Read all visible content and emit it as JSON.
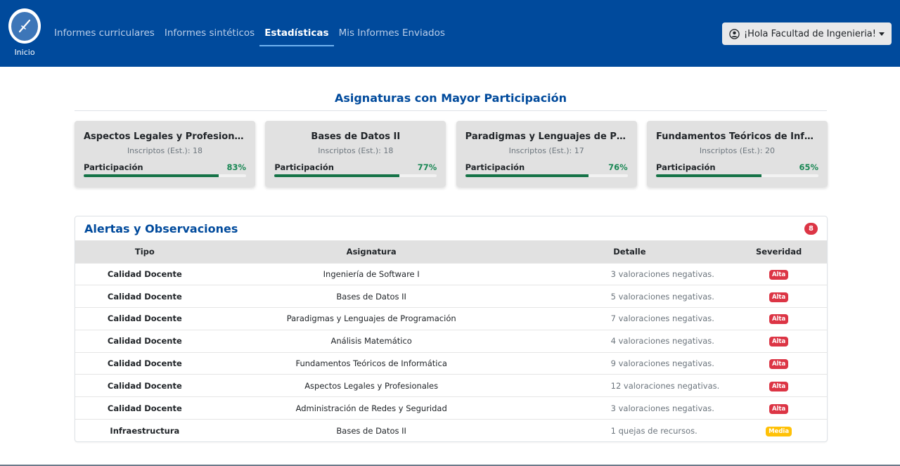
{
  "nav": {
    "brand_label": "Inicio",
    "links": [
      {
        "label": "Informes curriculares",
        "active": false
      },
      {
        "label": "Informes sintéticos",
        "active": false
      },
      {
        "label": "Estadísticas",
        "active": true
      },
      {
        "label": "Mis Informes Enviados",
        "active": false
      }
    ],
    "user_label": "¡Hola Facultad de Ingenieria!"
  },
  "participation": {
    "title": "Asignaturas con Mayor Participación",
    "cards": [
      {
        "title": "Aspectos Legales y Profesionales",
        "subtitle": "Inscriptos (Est.): 18",
        "label": "Participación",
        "percent_label": "83%",
        "percent": 83
      },
      {
        "title": "Bases de Datos II",
        "subtitle": "Inscriptos (Est.): 18",
        "label": "Participación",
        "percent_label": "77%",
        "percent": 77
      },
      {
        "title": "Paradigmas y Lenguajes de Progr...",
        "subtitle": "Inscriptos (Est.): 17",
        "label": "Participación",
        "percent_label": "76%",
        "percent": 76
      },
      {
        "title": "Fundamentos Teóricos de Inform...",
        "subtitle": "Inscriptos (Est.): 20",
        "label": "Participación",
        "percent_label": "65%",
        "percent": 65
      }
    ]
  },
  "alerts": {
    "title": "Alertas y Observaciones",
    "count": "8",
    "columns": [
      "Tipo",
      "Asignatura",
      "Detalle",
      "Severidad"
    ],
    "rows": [
      {
        "tipo": "Calidad Docente",
        "asignatura": "Ingeniería de Software I",
        "detalle": "3 valoraciones negativas.",
        "severidad": "Alta"
      },
      {
        "tipo": "Calidad Docente",
        "asignatura": "Bases de Datos II",
        "detalle": "5 valoraciones negativas.",
        "severidad": "Alta"
      },
      {
        "tipo": "Calidad Docente",
        "asignatura": "Paradigmas y Lenguajes de Programación",
        "detalle": "7 valoraciones negativas.",
        "severidad": "Alta"
      },
      {
        "tipo": "Calidad Docente",
        "asignatura": "Análisis Matemático",
        "detalle": "4 valoraciones negativas.",
        "severidad": "Alta"
      },
      {
        "tipo": "Calidad Docente",
        "asignatura": "Fundamentos Teóricos de Informática",
        "detalle": "9 valoraciones negativas.",
        "severidad": "Alta"
      },
      {
        "tipo": "Calidad Docente",
        "asignatura": "Aspectos Legales y Profesionales",
        "detalle": "12 valoraciones negativas.",
        "severidad": "Alta"
      },
      {
        "tipo": "Calidad Docente",
        "asignatura": "Administración de Redes y Seguridad",
        "detalle": "3 valoraciones negativas.",
        "severidad": "Alta"
      },
      {
        "tipo": "Infraestructura",
        "asignatura": "Bases de Datos II",
        "detalle": "1 quejas de recursos.",
        "severidad": "Media"
      }
    ]
  },
  "colors": {
    "navbar": "#004a9c",
    "accent": "#004a9c",
    "success": "#198754",
    "danger": "#dc3545",
    "warning": "#ffc107"
  },
  "icons": {
    "brand": "compass-logo-icon",
    "user": "user-circle-icon",
    "caret": "caret-down-icon"
  }
}
